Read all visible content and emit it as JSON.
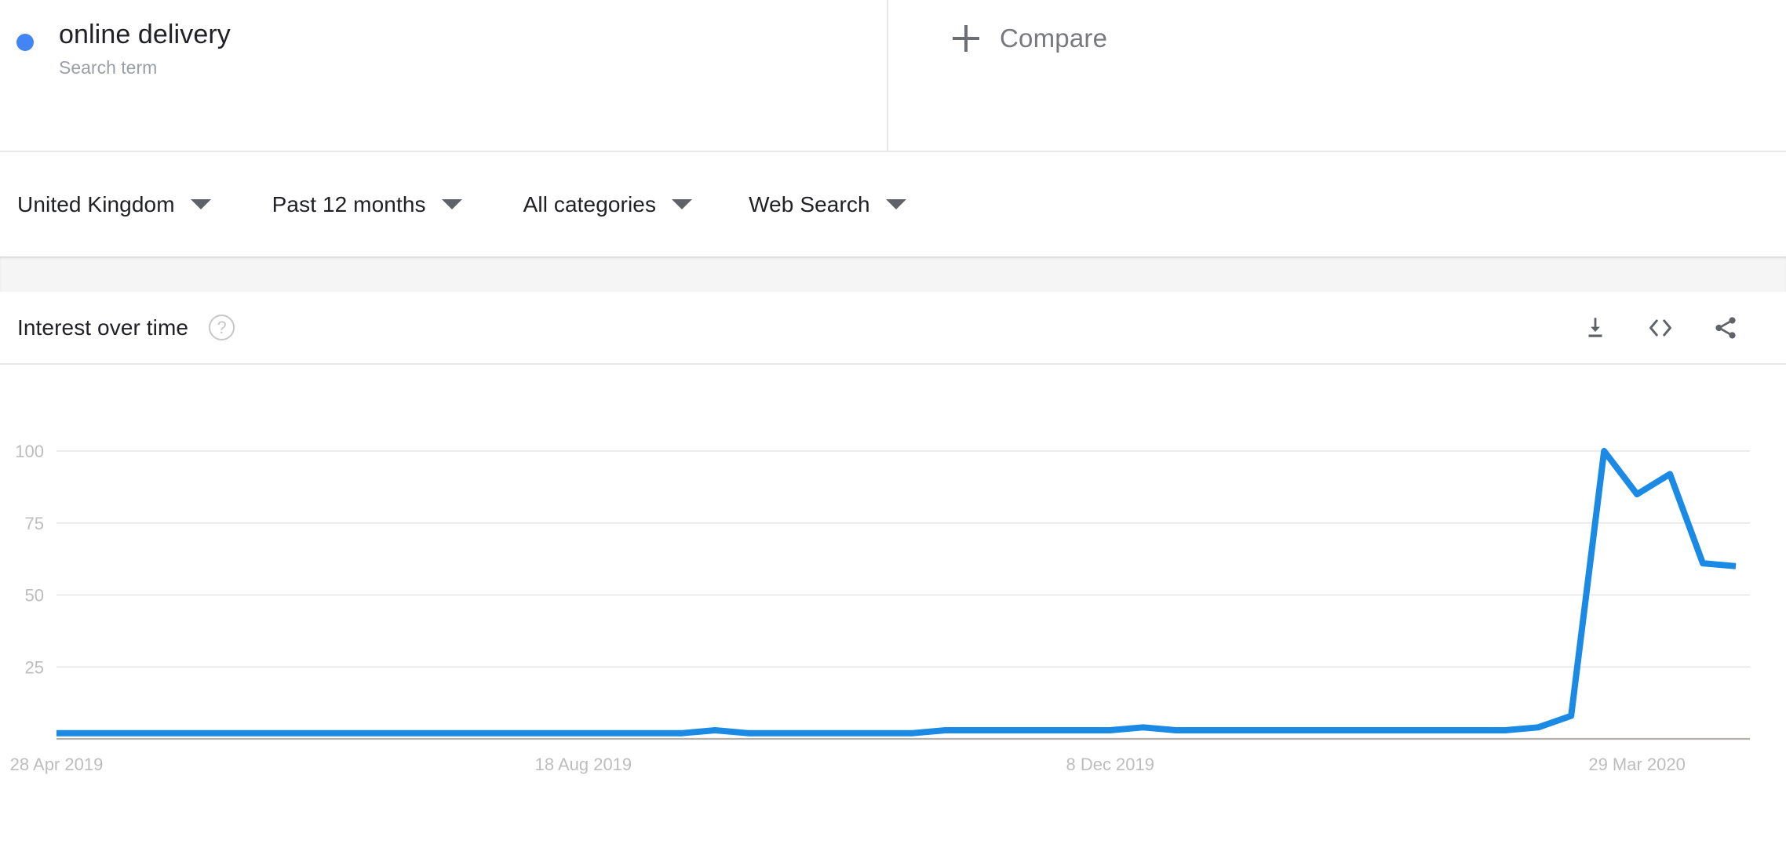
{
  "term": {
    "dot_color": "#4285f4",
    "title": "online delivery",
    "subtitle": "Search term"
  },
  "compare": {
    "label": "Compare",
    "icon": "plus-icon"
  },
  "filters": [
    {
      "label": "United Kingdom",
      "name": "location"
    },
    {
      "label": "Past 12 months",
      "name": "time-range"
    },
    {
      "label": "All categories",
      "name": "category"
    },
    {
      "label": "Web Search",
      "name": "search-type"
    }
  ],
  "chart_header": {
    "title": "Interest over time",
    "help_icon": "help-circle-icon",
    "actions": [
      {
        "name": "download-icon",
        "label": "Download"
      },
      {
        "name": "embed-code-icon",
        "label": "Embed"
      },
      {
        "name": "share-icon",
        "label": "Share"
      }
    ]
  },
  "chart_data": {
    "type": "line",
    "title": "Interest over time",
    "xlabel": "",
    "ylabel": "",
    "ylim": [
      0,
      100
    ],
    "grid": true,
    "legend": "online delivery",
    "line_color": "#1a8ae5",
    "y_ticks": [
      100,
      75,
      50,
      25
    ],
    "x_tick_labels": [
      "28 Apr 2019",
      "18 Aug 2019",
      "8 Dec 2019",
      "29 Mar 2020"
    ],
    "x_tick_indices": [
      0,
      16,
      32,
      48
    ],
    "x": [
      "28 Apr 2019",
      "5 May 2019",
      "12 May 2019",
      "19 May 2019",
      "26 May 2019",
      "2 Jun 2019",
      "9 Jun 2019",
      "16 Jun 2019",
      "23 Jun 2019",
      "30 Jun 2019",
      "7 Jul 2019",
      "14 Jul 2019",
      "21 Jul 2019",
      "28 Jul 2019",
      "4 Aug 2019",
      "11 Aug 2019",
      "18 Aug 2019",
      "25 Aug 2019",
      "1 Sep 2019",
      "8 Sep 2019",
      "15 Sep 2019",
      "22 Sep 2019",
      "29 Sep 2019",
      "6 Oct 2019",
      "13 Oct 2019",
      "20 Oct 2019",
      "27 Oct 2019",
      "3 Nov 2019",
      "10 Nov 2019",
      "17 Nov 2019",
      "24 Nov 2019",
      "1 Dec 2019",
      "8 Dec 2019",
      "15 Dec 2019",
      "22 Dec 2019",
      "29 Dec 2019",
      "5 Jan 2020",
      "12 Jan 2020",
      "19 Jan 2020",
      "26 Jan 2020",
      "2 Feb 2020",
      "9 Feb 2020",
      "16 Feb 2020",
      "23 Feb 2020",
      "1 Mar 2020",
      "8 Mar 2020",
      "15 Mar 2020",
      "22 Mar 2020",
      "29 Mar 2020",
      "5 Apr 2020",
      "12 Apr 2020",
      "19 Apr 2020"
    ],
    "values": [
      2,
      2,
      2,
      2,
      2,
      2,
      2,
      2,
      2,
      2,
      2,
      2,
      2,
      2,
      2,
      2,
      2,
      2,
      2,
      2,
      3,
      2,
      2,
      2,
      2,
      2,
      2,
      3,
      3,
      3,
      3,
      3,
      3,
      4,
      3,
      3,
      3,
      3,
      3,
      3,
      3,
      3,
      3,
      3,
      3,
      4,
      8,
      100,
      85,
      92,
      61,
      60
    ]
  }
}
